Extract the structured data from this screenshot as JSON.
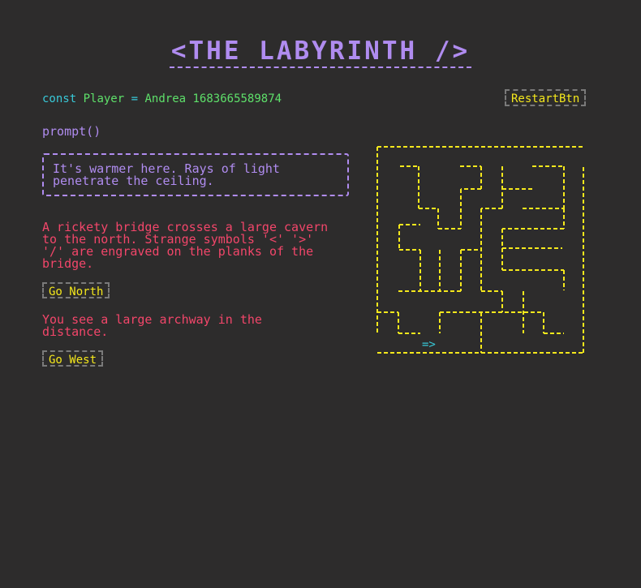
{
  "title": "<THE LABYRINTH />",
  "player": {
    "keyword": "const",
    "label": "Player",
    "equals": "=",
    "name": "Andrea",
    "id": "1683665589874"
  },
  "restart_label": "RestartBtn",
  "prompt_label": "prompt()",
  "prompt_text": "It's warmer here. Rays of light penetrate the ceiling.",
  "options": [
    {
      "description": "A rickety bridge crosses a large cavern to the north. Strange symbols '<' '>' '/' are engraved on the planks of the bridge.",
      "button_label": "Go North"
    },
    {
      "description": "You see a large archway in the distance.",
      "button_label": "Go West"
    }
  ],
  "maze": {
    "player_marker": "=>",
    "player_marker_color": "#38c9d8",
    "wall_color": "#f5e81c"
  },
  "colors": {
    "background": "#2d2c2c",
    "title": "#b08cf0",
    "keyword": "#38c9d8",
    "player": "#5ee06a",
    "button_text": "#f5e81c",
    "button_border": "#7a7a7a",
    "description": "#f2466a"
  }
}
